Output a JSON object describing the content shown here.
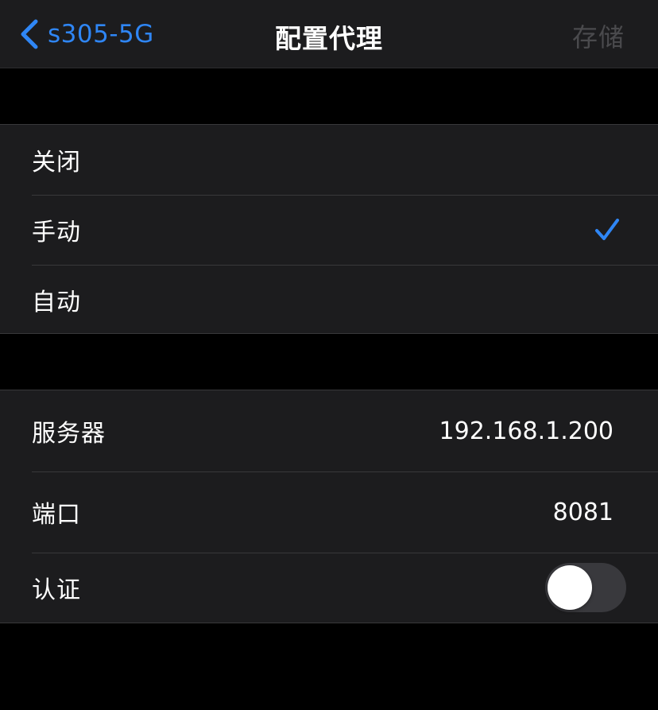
{
  "navbar": {
    "back_label": "s305-5G",
    "title": "配置代理",
    "save_label": "存储"
  },
  "proxy_mode": {
    "options": [
      {
        "label": "关闭",
        "selected": false
      },
      {
        "label": "手动",
        "selected": true
      },
      {
        "label": "自动",
        "selected": false
      }
    ]
  },
  "manual": {
    "server_label": "服务器",
    "server_value": "192.168.1.200",
    "port_label": "端口",
    "port_value": "8081",
    "auth_label": "认证",
    "auth_enabled": false
  },
  "colors": {
    "accent": "#2f86f5",
    "background": "#000000",
    "cell": "#1c1c1e",
    "disabled": "#4a4a4d",
    "toggle_off": "#39393d"
  },
  "icons": {
    "back": "chevron-left-icon",
    "check": "checkmark-icon"
  }
}
